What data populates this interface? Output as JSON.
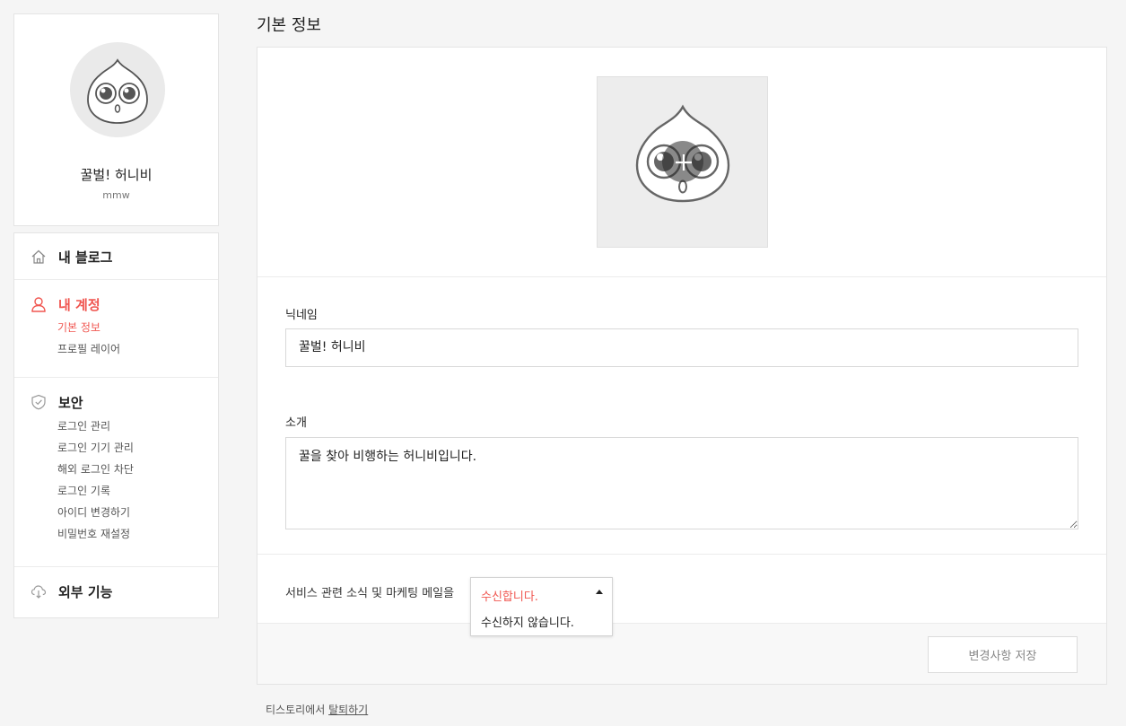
{
  "profile": {
    "name": "꿀벌! 허니비",
    "id_text": "mmw"
  },
  "menu": {
    "my_blog": "내 블로그",
    "account": {
      "label": "내 계정",
      "items": [
        "기본 정보",
        "프로필 레이어"
      ]
    },
    "security": {
      "label": "보안",
      "items": [
        "로그인 관리",
        "로그인 기기 관리",
        "해외 로그인 차단",
        "로그인 기록",
        "아이디 변경하기",
        "비밀번호 재설정"
      ]
    },
    "external": "외부 기능"
  },
  "page": {
    "title": "기본 정보"
  },
  "form": {
    "nickname_label": "닉네임",
    "nickname_value": "꿀벌! 허니비",
    "intro_label": "소개",
    "intro_value": "꿀을 찾아 비행하는 허니비입니다.",
    "mail_label": "서비스 관련 소식 및 마케팅 메일을",
    "mail_selected": "수신합니다.",
    "mail_option": "수신하지 않습니다.",
    "save_label": "변경사항 저장"
  },
  "footer": {
    "withdraw_prefix": "티스토리에서 ",
    "withdraw_link": "탈퇴하기"
  },
  "colors": {
    "accent": "#f05650",
    "background": "#f5f5f5"
  },
  "icons": {
    "home": "home-icon",
    "account": "user-icon",
    "security": "shield-icon",
    "external": "cloud-icon",
    "photo_add": "plus-icon"
  }
}
